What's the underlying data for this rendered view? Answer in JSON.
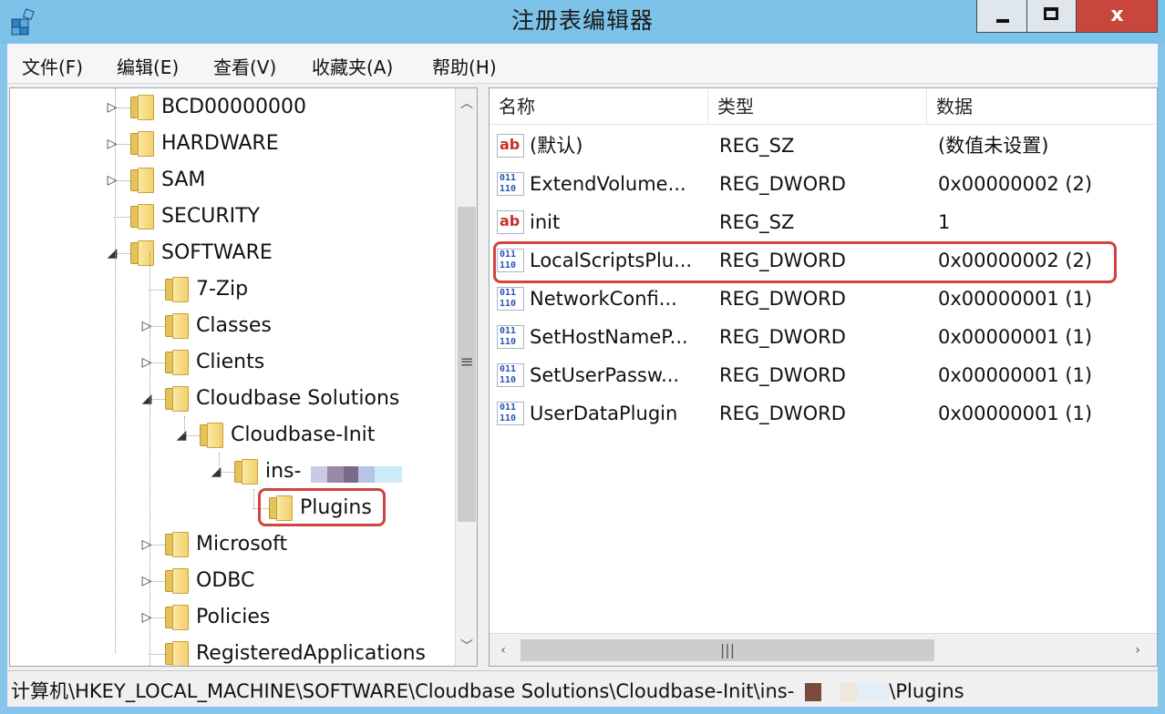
{
  "window": {
    "title": "注册表编辑器",
    "close_glyph": "x"
  },
  "menu": [
    {
      "label": "文件(F)"
    },
    {
      "label": "编辑(E)"
    },
    {
      "label": "查看(V)"
    },
    {
      "label": "收藏夹(A)"
    },
    {
      "label": "帮助(H)"
    }
  ],
  "tree": {
    "items": [
      {
        "label": "BCD00000000",
        "level": 0,
        "expander": "▷"
      },
      {
        "label": "HARDWARE",
        "level": 0,
        "expander": "▷"
      },
      {
        "label": "SAM",
        "level": 0,
        "expander": "▷"
      },
      {
        "label": "SECURITY",
        "level": 0,
        "expander": ""
      },
      {
        "label": "SOFTWARE",
        "level": 0,
        "expander": "◢"
      },
      {
        "label": "7-Zip",
        "level": 1,
        "expander": ""
      },
      {
        "label": "Classes",
        "level": 1,
        "expander": "▷"
      },
      {
        "label": "Clients",
        "level": 1,
        "expander": "▷"
      },
      {
        "label": "Cloudbase Solutions",
        "level": 1,
        "expander": "◢"
      },
      {
        "label": "Cloudbase-Init",
        "level": 2,
        "expander": "◢"
      },
      {
        "label": "ins-",
        "level": 3,
        "expander": "◢"
      },
      {
        "label": "Plugins",
        "level": 4,
        "expander": ""
      },
      {
        "label": "Microsoft",
        "level": 1,
        "expander": "▷"
      },
      {
        "label": "ODBC",
        "level": 1,
        "expander": "▷"
      },
      {
        "label": "Policies",
        "level": 1,
        "expander": "▷"
      },
      {
        "label": "RegisteredApplications",
        "level": 1,
        "expander": ""
      }
    ]
  },
  "list": {
    "columns": [
      "名称",
      "类型",
      "数据"
    ],
    "rows": [
      {
        "name": "(默认)",
        "type": "REG_SZ",
        "data": "(数值未设置)",
        "icon": "string-value-icon"
      },
      {
        "name": "ExtendVolume...",
        "type": "REG_DWORD",
        "data": "0x00000002 (2)",
        "icon": "binary-value-icon"
      },
      {
        "name": "init",
        "type": "REG_SZ",
        "data": "1",
        "icon": "string-value-icon"
      },
      {
        "name": "LocalScriptsPlu...",
        "type": "REG_DWORD",
        "data": "0x00000002 (2)",
        "icon": "binary-value-icon"
      },
      {
        "name": "NetworkConfi...",
        "type": "REG_DWORD",
        "data": "0x00000001 (1)",
        "icon": "binary-value-icon"
      },
      {
        "name": "SetHostNameP...",
        "type": "REG_DWORD",
        "data": "0x00000001 (1)",
        "icon": "binary-value-icon"
      },
      {
        "name": "SetUserPassw...",
        "type": "REG_DWORD",
        "data": "0x00000001 (1)",
        "icon": "binary-value-icon"
      },
      {
        "name": "UserDataPlugin",
        "type": "REG_DWORD",
        "data": "0x00000001 (1)",
        "icon": "binary-value-icon"
      }
    ]
  },
  "status": {
    "path_prefix": "计算机\\HKEY_LOCAL_MACHINE\\SOFTWARE\\Cloudbase Solutions\\Cloudbase-Init\\ins-",
    "path_suffix": "\\Plugins"
  },
  "colors": {
    "highlight": "#d0453f",
    "titlebar": "#7dc2e8",
    "close": "#c9463d"
  }
}
